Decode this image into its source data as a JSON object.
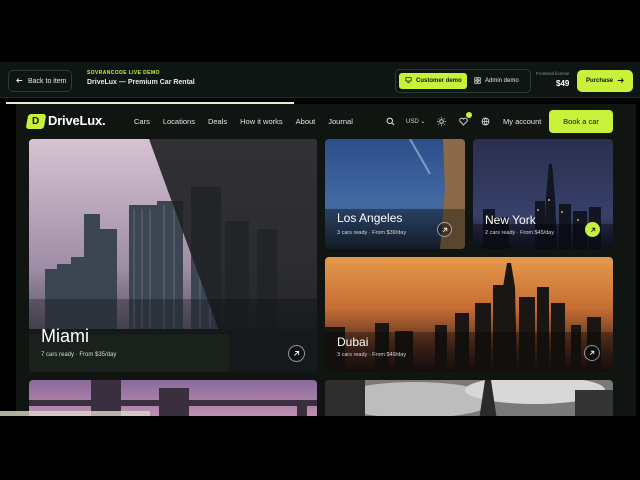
{
  "demo_bar": {
    "back_label": "Back to item",
    "tag": "SOVRANCODE LIVE DEMO",
    "title": "DriveLux — Premium Car Rental",
    "customer_demo": "Customer demo",
    "admin_demo": "Admin demo",
    "license_label": "Frontend license",
    "price": "$49",
    "purchase": "Purchase"
  },
  "header": {
    "logo_letter": "D",
    "logo": "DriveLux.",
    "nav": [
      "Cars",
      "Locations",
      "Deals",
      "How it works",
      "About",
      "Journal"
    ],
    "currency": "USD",
    "account": "My account",
    "book": "Book a car"
  },
  "locations": [
    {
      "city": "Miami",
      "meta": "7 cars ready · From $35/day"
    },
    {
      "city": "Los Angeles",
      "meta": "3 cars ready · From $39/day"
    },
    {
      "city": "New York",
      "meta": "2 cars ready · From $45/day"
    },
    {
      "city": "Dubai",
      "meta": "3 cars ready · From $49/day"
    }
  ],
  "colors": {
    "accent": "#c8f23a",
    "background": "#111512",
    "bar": "#0e1512"
  }
}
